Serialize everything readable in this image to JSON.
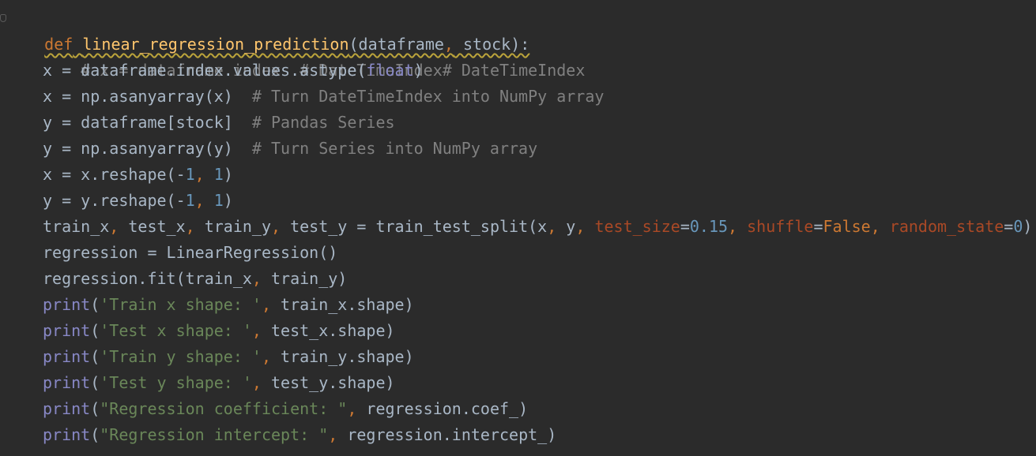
{
  "editor": {
    "theme_colors": {
      "background": "#2b2b2b",
      "default_text": "#a9b7c6",
      "keyword": "#cc7832",
      "function_name": "#ffc66d",
      "comment": "#808080",
      "number": "#6897bb",
      "string": "#6a8759",
      "keyword_argument": "#aa4926",
      "builtin": "#8888c6"
    },
    "lines": [
      {
        "t0": "def",
        "t1": " ",
        "t2": "linear_regression_prediction",
        "t3": "(dataframe",
        "t4": ",",
        "t5": " stock):"
      },
      {
        "t0": "# x = dataframe.index  # DateTimeIndex"
      },
      {
        "t0": "x = dataframe.index.values.astype(",
        "t1": "float",
        "t2": ")  ",
        "t3": "# DateTimeIndex"
      },
      {
        "t0": "x = np.asanyarray(x)  ",
        "t1": "# Turn DateTimeIndex into NumPy array"
      },
      {
        "t0": "y = dataframe[stock]  ",
        "t1": "# Pandas Series"
      },
      {
        "t0": "y = np.asanyarray(y)  ",
        "t1": "# Turn Series into NumPy array"
      },
      {
        "t0": "x = x.reshape(-",
        "t1": "1",
        "t2": ",",
        "t3": " ",
        "t4": "1",
        "t5": ")"
      },
      {
        "t0": "y = y.reshape(-",
        "t1": "1",
        "t2": ",",
        "t3": " ",
        "t4": "1",
        "t5": ")"
      },
      {
        "t0": "train_x",
        "t1": ",",
        "t2": " test_x",
        "t3": ",",
        "t4": " train_y",
        "t5": ",",
        "t6": " test_y = train_test_split(x",
        "t7": ",",
        "t8": " y",
        "t9": ",",
        "t10": " ",
        "t11": "test_size",
        "t12": "=",
        "t13": "0.15",
        "t14": ",",
        "t15": " ",
        "t16": "shuffle",
        "t17": "=",
        "t18": "False",
        "t19": ",",
        "t20": " ",
        "t21": "random_state",
        "t22": "=",
        "t23": "0",
        "t24": ")"
      },
      {
        "t0": "regression = LinearRegression()"
      },
      {
        "t0": "regression.fit(train_x",
        "t1": ",",
        "t2": " train_y)"
      },
      {
        "t0": "print",
        "t1": "(",
        "t2": "'Train x shape: '",
        "t3": ",",
        "t4": " train_x.shape)"
      },
      {
        "t0": "print",
        "t1": "(",
        "t2": "'Test x shape: '",
        "t3": ",",
        "t4": " test_x.shape)"
      },
      {
        "t0": "print",
        "t1": "(",
        "t2": "'Train y shape: '",
        "t3": ",",
        "t4": " train_y.shape)"
      },
      {
        "t0": "print",
        "t1": "(",
        "t2": "'Test y shape: '",
        "t3": ",",
        "t4": " test_y.shape)"
      },
      {
        "t0": "print",
        "t1": "(",
        "t2": "\"Regression coefficient: \"",
        "t3": ",",
        "t4": " regression.coef_)"
      },
      {
        "t0": "print",
        "t1": "(",
        "t2": "\"Regression intercept: \"",
        "t3": ",",
        "t4": " regression.intercept_)"
      }
    ]
  }
}
